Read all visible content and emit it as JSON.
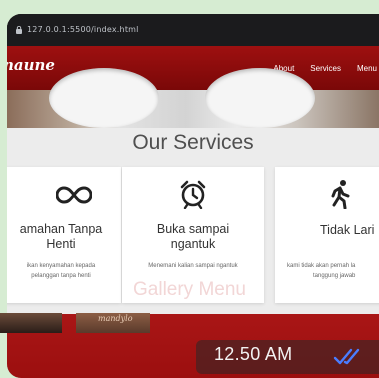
{
  "browser": {
    "url": "127.0.0.1:5500/index.html"
  },
  "site": {
    "brand": "naune",
    "nav": [
      "About",
      "Services",
      "Menu"
    ],
    "services_title": "Our Services",
    "services": [
      {
        "icon": "infinity-icon",
        "title_lines": [
          "amahan Tanpa",
          "Henti"
        ],
        "desc_lines": [
          "ikan kenyamahan kepada",
          "pelanggan tanpa henti"
        ]
      },
      {
        "icon": "alarm-clock-icon",
        "title_lines": [
          "Buka sampai",
          "ngantuk"
        ],
        "desc_lines": [
          "Menemani kalian sampai ngantuk"
        ]
      },
      {
        "icon": "running-person-icon",
        "title_lines": [
          "Tidak Lari"
        ],
        "desc_lines": [
          "kami tidak akan pernah la",
          "tanggung jawab"
        ]
      }
    ],
    "gallery_title": "Gallery Menu",
    "gallery_caption": "mandylo"
  },
  "message": {
    "time": "12.50 AM",
    "status_icon": "double-check-icon",
    "status_color": "#4a7dff"
  },
  "colors": {
    "nav_red": "#9e1010",
    "gallery_red": "#a91616",
    "background": "#d6ecd2"
  }
}
